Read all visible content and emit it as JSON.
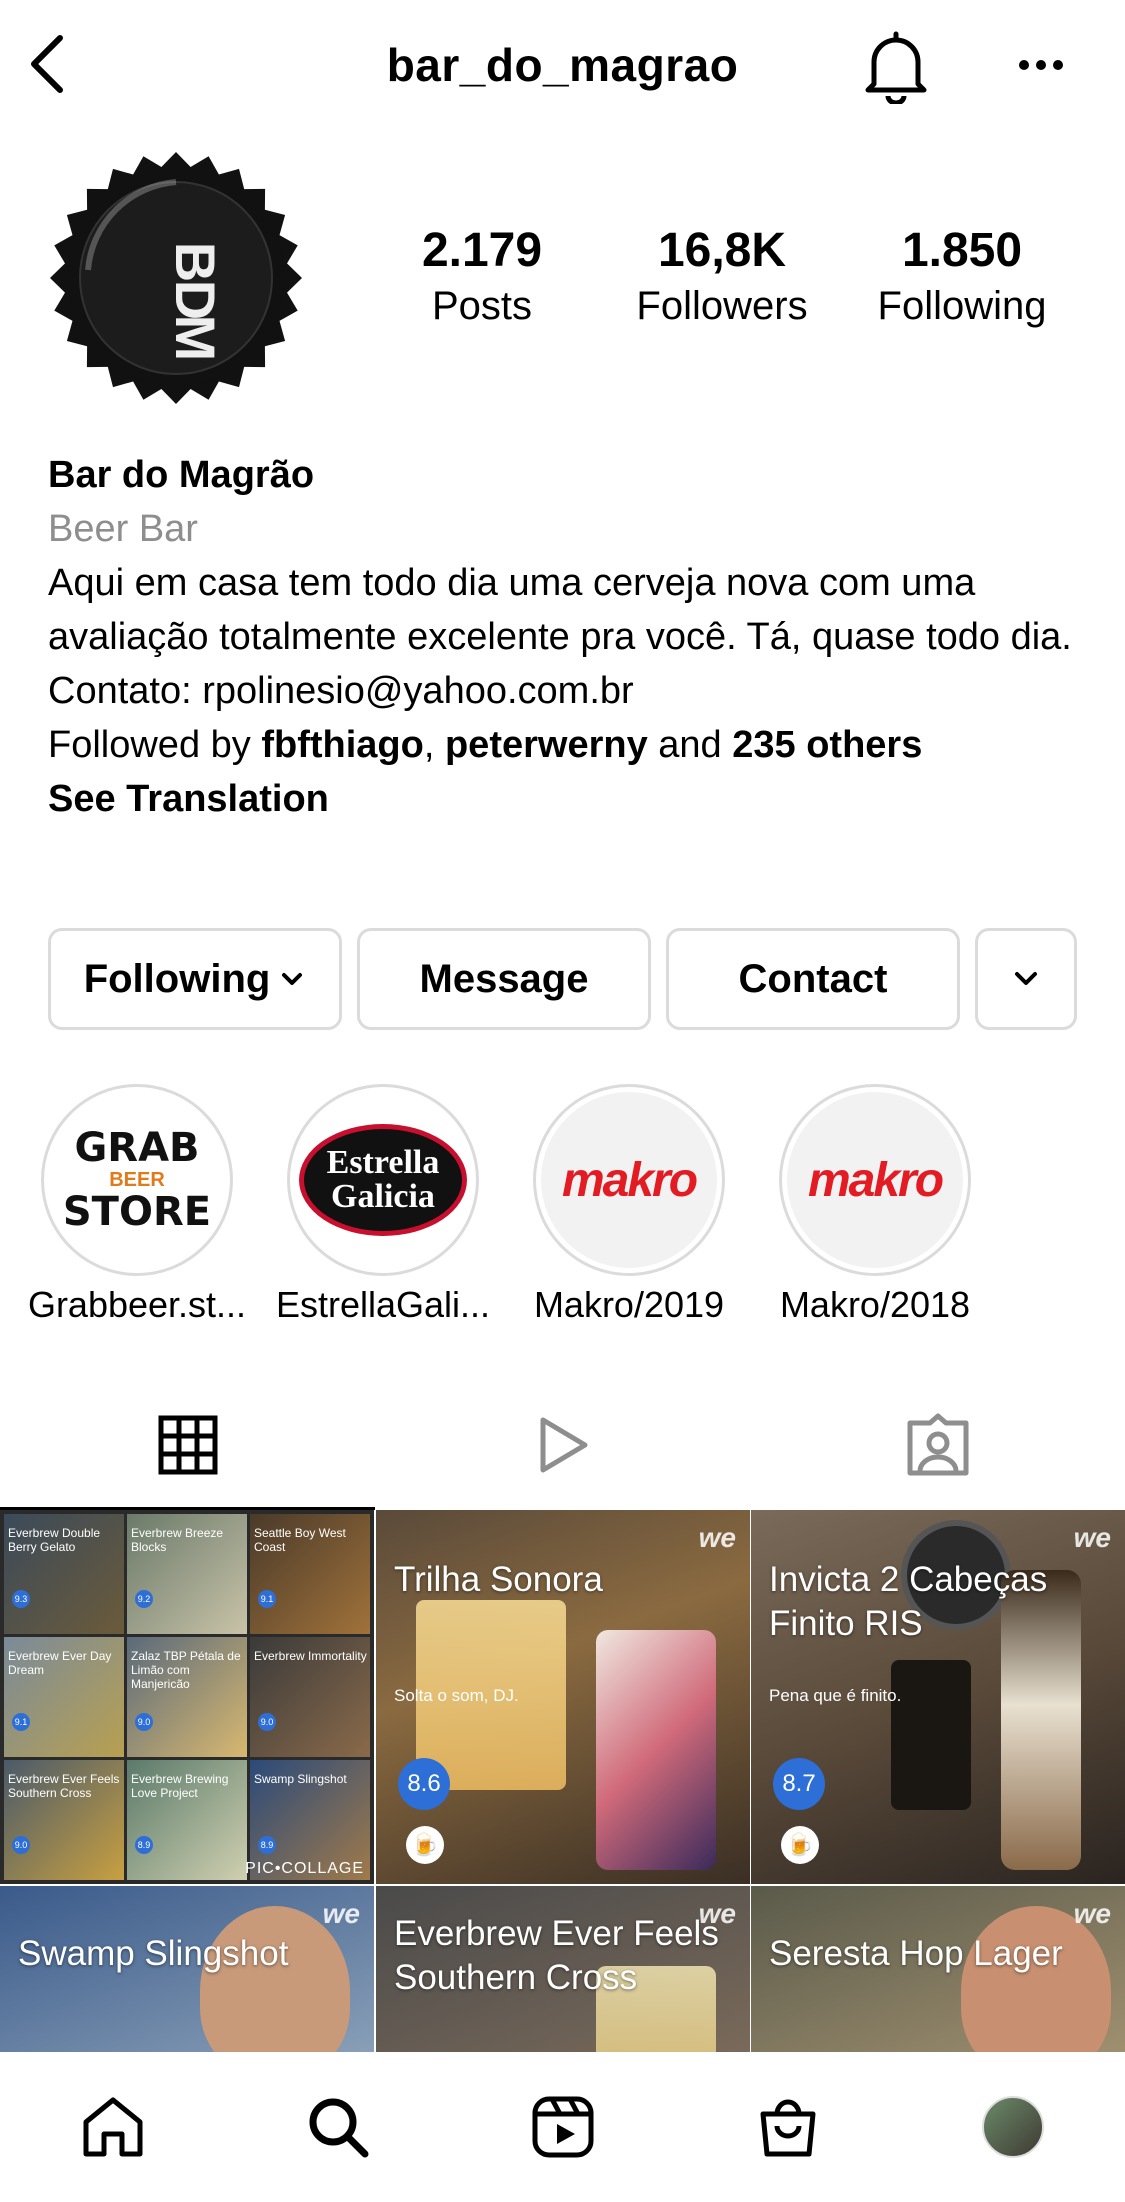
{
  "header": {
    "username": "bar_do_magrao",
    "back_icon": "chevron-left-icon",
    "bell_icon": "bell-icon",
    "more_icon": "more-horizontal-icon"
  },
  "profile": {
    "avatar_logo": "BDM",
    "stats": [
      {
        "value": "2.179",
        "label": "Posts"
      },
      {
        "value": "16,8K",
        "label": "Followers"
      },
      {
        "value": "1.850",
        "label": "Following"
      }
    ]
  },
  "bio": {
    "name": "Bar do Magrão",
    "category": "Beer Bar",
    "text": "Aqui em casa tem todo dia uma cerveja nova com uma avaliação totalmente excelente pra você. Tá, quase todo dia.",
    "contact": "Contato: rpolinesio@yahoo.com.br",
    "followed_by_prefix": "Followed by ",
    "followed_user_1": "fbfthiago",
    "followed_sep": ", ",
    "followed_user_2": "peterwerny",
    "followed_and": " and ",
    "followed_others": "235 others",
    "see_translation": "See Translation"
  },
  "buttons": {
    "following": "Following",
    "message": "Message",
    "contact": "Contact"
  },
  "highlights": [
    {
      "label": "Grabbeer.st...",
      "line1": "GRAB",
      "line2": "BEER",
      "line3": "STORE"
    },
    {
      "label": "EstrellaGali...",
      "line1": "Estrella",
      "line2": "Galicia"
    },
    {
      "label": "Makro/2019",
      "logo": "makro"
    },
    {
      "label": "Makro/2018",
      "logo": "makro"
    }
  ],
  "tabs": [
    "grid-icon",
    "reels-icon",
    "tagged-icon"
  ],
  "posts": [
    {
      "type": "collage",
      "minis": [
        {
          "title": "Everbrew Double Berry Gelato",
          "score": "9.3"
        },
        {
          "title": "Everbrew Breeze Blocks",
          "score": "9.2"
        },
        {
          "title": "Seattle Boy West Coast",
          "score": "9.1"
        },
        {
          "title": "Everbrew Ever Day Dream",
          "score": "9.1"
        },
        {
          "title": "Zalaz TBP Pétala de Limão com Manjericão",
          "score": "9.0"
        },
        {
          "title": "Everbrew Immortality",
          "score": "9.0"
        },
        {
          "title": "Everbrew Ever Feels Southern Cross",
          "score": "9.0"
        },
        {
          "title": "Everbrew Brewing Love Project",
          "score": "8.9"
        },
        {
          "title": "Swamp Slingshot",
          "score": "8.9"
        }
      ],
      "watermark": "PIC•COLLAGE"
    },
    {
      "title": "Trilha Sonora",
      "subtitle": "Solta o som, DJ.",
      "score": "8.6",
      "watermark": "we"
    },
    {
      "title": "Invicta 2 Cabeças Finito RIS",
      "subtitle": "Pena que é finito.",
      "score": "8.7",
      "watermark": "we"
    },
    {
      "title": "Swamp Slingshot",
      "watermark": "we"
    },
    {
      "title": "Everbrew Ever Feels Southern Cross",
      "watermark": "we"
    },
    {
      "title": "Seresta Hop Lager",
      "watermark": "we"
    }
  ],
  "bottom_nav": [
    "home-icon",
    "search-icon",
    "reels-icon",
    "shop-icon",
    "profile-avatar"
  ]
}
